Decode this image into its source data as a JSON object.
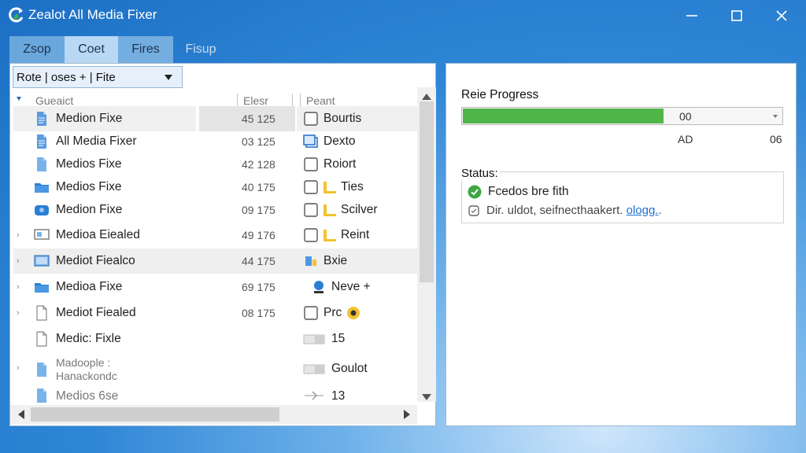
{
  "window": {
    "title": "Zealot All Media Fixer",
    "logo_icon": "refresh-logo-icon",
    "controls": [
      "minimize-icon",
      "maximize-icon",
      "close-icon"
    ]
  },
  "tabs": [
    {
      "label": "Zsop"
    },
    {
      "label": "Coet",
      "active": true
    },
    {
      "label": "Fires"
    },
    {
      "label": "Fisup"
    }
  ],
  "toolbar": {
    "combo_label": "Rote | oses  + | Fite"
  },
  "file_list": {
    "columns": [
      "Gueaict",
      "Elesr",
      "Peant"
    ],
    "rows": [
      {
        "name": "Medion Fixe",
        "size": "45 125",
        "third": "Bourtis",
        "name_icon": "document-icon",
        "third_icon": "checkbox-icon"
      },
      {
        "name": "All Media Fixer",
        "size": "03 125",
        "third": "Dexto",
        "name_icon": "document-icon",
        "third_icon": "window-icon"
      },
      {
        "name": "Medios Fixe",
        "size": "42 128",
        "third": "Roiort",
        "name_icon": "document-icon",
        "third_icon": "checkbox-icon"
      },
      {
        "name": "Medios Fixe",
        "size": "40 175",
        "third": "Ties",
        "name_icon": "folder-icon",
        "third_icon": "checkbox-icon",
        "third_icon2": "folder-icon"
      },
      {
        "name": "Medion Fixe",
        "size": "09 175",
        "third": "Scilver",
        "name_icon": "disk-icon",
        "third_icon": "checkbox-icon",
        "third_icon2": "folder-icon"
      },
      {
        "name": "Medioa Eiealed",
        "size": "49 176",
        "third": "Reint",
        "name_icon": "monitor-icon",
        "third_icon": "checkbox-icon",
        "third_icon2": "folder-icon"
      },
      {
        "name": "Mediot Fiealco",
        "size": "44 175",
        "third": "Bxie",
        "name_icon": "monitor-icon",
        "third_icon": "app-icon"
      },
      {
        "name": "Medioa Fixe",
        "size": "69 175",
        "third": "Neve  +",
        "name_icon": "folder-icon",
        "third_icon": "pin-icon"
      },
      {
        "name": "Mediot Fiealed",
        "size": "08 175",
        "third": "Prc",
        "name_icon": "document-icon",
        "third_icon": "checkbox-icon",
        "third_icon2": "badge-icon"
      },
      {
        "name": "Medic: Fixle",
        "size": "",
        "third": "15",
        "name_icon": "document-icon",
        "third_icon": "toggle-icon"
      },
      {
        "name": "Madoople :\nHanackondc",
        "size": "",
        "third": "Goulot",
        "name_icon": "document-icon",
        "third_icon": "toggle-icon"
      },
      {
        "name": "Medios 6se",
        "size": "",
        "third": "13",
        "name_icon": "document-icon",
        "third_icon": "arrow-icon"
      }
    ]
  },
  "progress": {
    "label": "Reie Progress",
    "fraction": 0.63,
    "value_text": "00",
    "sub_left": "AD",
    "sub_right": "06",
    "fill_color": "#4fb548"
  },
  "status": {
    "label": "Status:",
    "line1": "Fcedos bre fith",
    "line2_prefix": "Dir. uldot, seifnecthaakert.",
    "line2_link": "ologg.",
    "line2_suffix": ".",
    "ok_color": "#3ea744"
  }
}
